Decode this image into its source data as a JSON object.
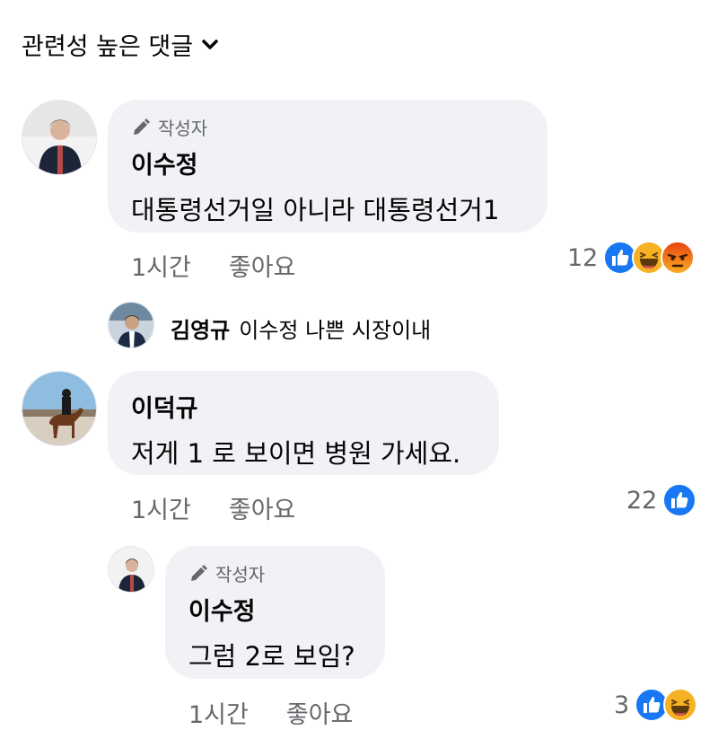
{
  "sort": {
    "label": "관련성 높은 댓글"
  },
  "colors": {
    "like_blue": "#1877f2",
    "bubble_bg": "#f0f2f5",
    "meta_gray": "#65676b",
    "haha_yellow": "#f7b125",
    "angry_red": "#e9710f"
  },
  "comments": [
    {
      "badge": "작성자",
      "author": "이수정",
      "text": "대통령선거일 아니라 대통령선거1",
      "time": "1시간",
      "like": "좋아요",
      "reaction_count": "12",
      "reactions": [
        "like-icon",
        "haha-icon",
        "angry-icon"
      ]
    },
    {
      "author": "이덕규",
      "text": "저게 1 로 보이면 병원 가세요.",
      "time": "1시간",
      "like": "좋아요",
      "reaction_count": "22",
      "reactions": [
        "like-icon"
      ]
    }
  ],
  "reply_preview": {
    "author": "김영규",
    "text": "이수정 나쁜 시장이내"
  },
  "reply": {
    "badge": "작성자",
    "author": "이수정",
    "text": "그럼 2로 보임?",
    "time": "1시간",
    "like": "좋아요",
    "reaction_count": "3",
    "reactions": [
      "like-icon",
      "haha-icon"
    ]
  }
}
